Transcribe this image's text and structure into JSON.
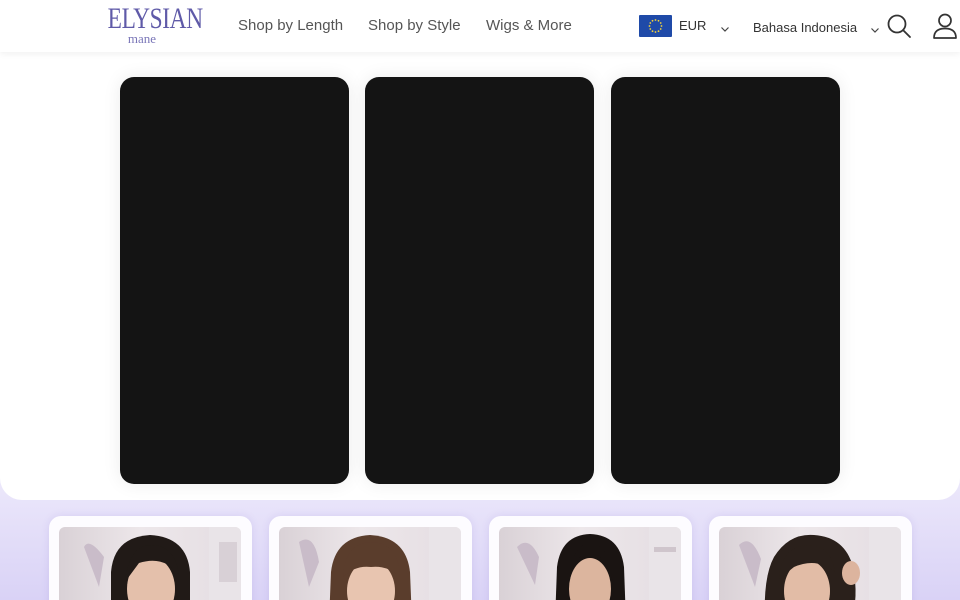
{
  "brand": {
    "name": "ELYSIAN",
    "tagline": "mane",
    "color": "#5f5aa8"
  },
  "nav": {
    "items": [
      {
        "label": "Shop by Length"
      },
      {
        "label": "Shop by Style"
      },
      {
        "label": "Wigs & More"
      }
    ]
  },
  "header": {
    "currency": {
      "selected": "EUR",
      "flag_icon": "eu-flag-icon"
    },
    "language": {
      "selected": "Bahasa Indonesia"
    },
    "search_icon": "search-icon",
    "account_icon": "user-icon"
  },
  "videos": {
    "count": 3,
    "background": "#141414"
  },
  "products": {
    "count": 4,
    "section_gradient": [
      "#ece8fb",
      "#d9d2f6"
    ],
    "hair_styles": [
      "dark-bob",
      "brown-bangs",
      "long-dark-straight",
      "dark-wavy"
    ]
  }
}
